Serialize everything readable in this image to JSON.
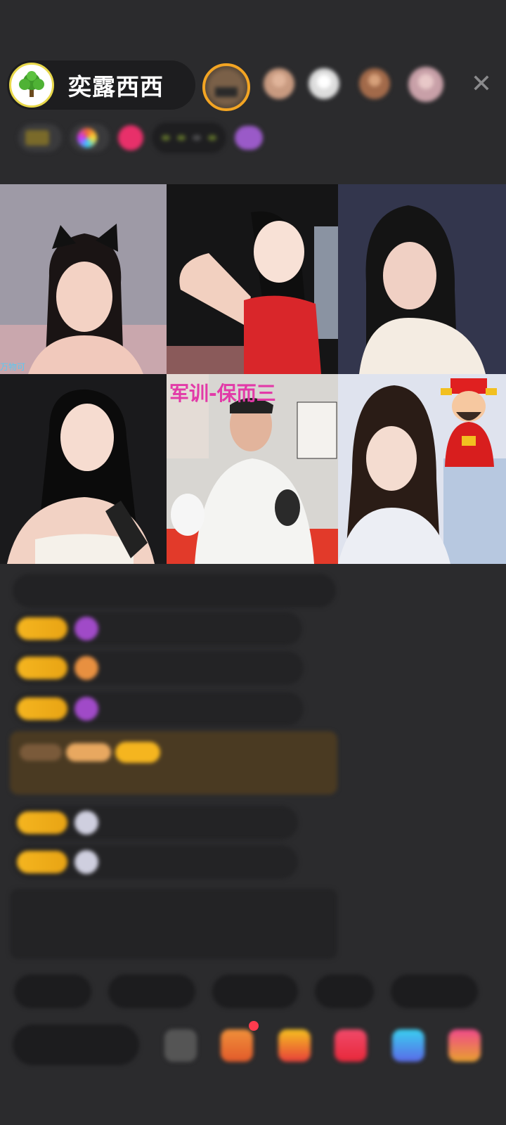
{
  "host": {
    "name": "奕露西西",
    "avatar_icon": "tree-logo-icon"
  },
  "viewers": [
    {
      "icon": "viewer-avatar-icon",
      "ring": "#f5a623"
    },
    {
      "icon": "viewer-avatar-icon",
      "ring": "none"
    },
    {
      "icon": "viewer-avatar-icon",
      "ring": "none"
    },
    {
      "icon": "viewer-avatar-icon",
      "ring": "none"
    },
    {
      "icon": "viewer-avatar-icon",
      "ring": "none"
    }
  ],
  "close_icon": "close-icon",
  "info_bar": {
    "chip1": "",
    "chip2": "",
    "task_segments": [
      "",
      "",
      "",
      ""
    ]
  },
  "video_tiles": [
    {
      "label": "",
      "mini": "万物可"
    },
    {
      "label": ""
    },
    {
      "label": ""
    },
    {
      "label": ""
    },
    {
      "label": "军训-保而三"
    },
    {
      "label": ""
    }
  ],
  "chat": {
    "welcome": "",
    "messages": [
      {
        "badge": "",
        "icon": "diamond-icon",
        "name": "",
        "text": ""
      },
      {
        "badge": "",
        "icon": "flame-icon",
        "name": "",
        "text": ""
      },
      {
        "badge": "",
        "icon": "diamond-icon",
        "name": "",
        "text": ""
      },
      {
        "badge": "",
        "icon": "ring-icon",
        "name": "",
        "text": ""
      },
      {
        "badge": "",
        "icon": "ring-icon",
        "name": "",
        "text": ""
      }
    ],
    "highlight_text": "",
    "system_notice": ""
  },
  "quick_replies": [
    "",
    "",
    "",
    "",
    ""
  ],
  "input": {
    "placeholder": ""
  },
  "bottom_icons": [
    "more-icon",
    "gift-box-icon",
    "red-packet-icon",
    "game-icon",
    "wishlist-icon",
    "fan-club-icon"
  ],
  "colors": {
    "background": "#2b2b2d",
    "accent_gold": "#f5b51f",
    "name_purple": "#b39ae6",
    "name_teal": "#4fd0c4",
    "notice_green": "#9fe07a",
    "overlay_pink": "#e23aa8"
  }
}
